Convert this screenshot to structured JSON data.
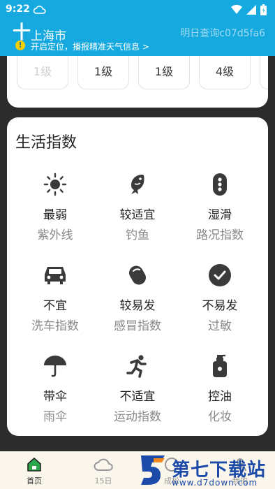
{
  "status": {
    "time": "9:22"
  },
  "header": {
    "plus": "十",
    "city": "上海市",
    "query": "明日查询c07d5fa6",
    "warn": "!",
    "hint": "开启定位，播报精准天气信息 >"
  },
  "aqi_levels": [
    "1级",
    "1级",
    "1级",
    "4级"
  ],
  "life": {
    "title": "生活指数",
    "items": [
      {
        "level": "最弱",
        "name": "紫外线",
        "icon": "sun-icon"
      },
      {
        "level": "较适宜",
        "name": "钓鱼",
        "icon": "fish-icon"
      },
      {
        "level": "湿滑",
        "name": "路况指数",
        "icon": "traffic-light-icon"
      },
      {
        "level": "不宜",
        "name": "洗车指数",
        "icon": "car-icon"
      },
      {
        "level": "较易发",
        "name": "感冒指数",
        "icon": "pill-icon"
      },
      {
        "level": "不易发",
        "name": "过敏",
        "icon": "check-circle-icon"
      },
      {
        "level": "带伞",
        "name": "雨伞",
        "icon": "umbrella-icon"
      },
      {
        "level": "不适宜",
        "name": "运动指数",
        "icon": "running-icon"
      },
      {
        "level": "控油",
        "name": "化妆",
        "icon": "lotion-bottle-icon"
      }
    ]
  },
  "tabs": [
    {
      "label": "首页",
      "icon": "home-icon",
      "active": true
    },
    {
      "label": "15日",
      "icon": "cloud-icon",
      "active": false
    },
    {
      "label": "成松",
      "icon": "circle-icon",
      "active": false
    },
    {
      "label": "我的",
      "icon": "person-icon",
      "active": false
    }
  ],
  "watermark": {
    "brand": "第七下载站",
    "url": "www.d7down.com"
  },
  "colors": {
    "header": "#16a9df",
    "icon": "#3a3a3a",
    "active_tab": "#2ba84a"
  }
}
